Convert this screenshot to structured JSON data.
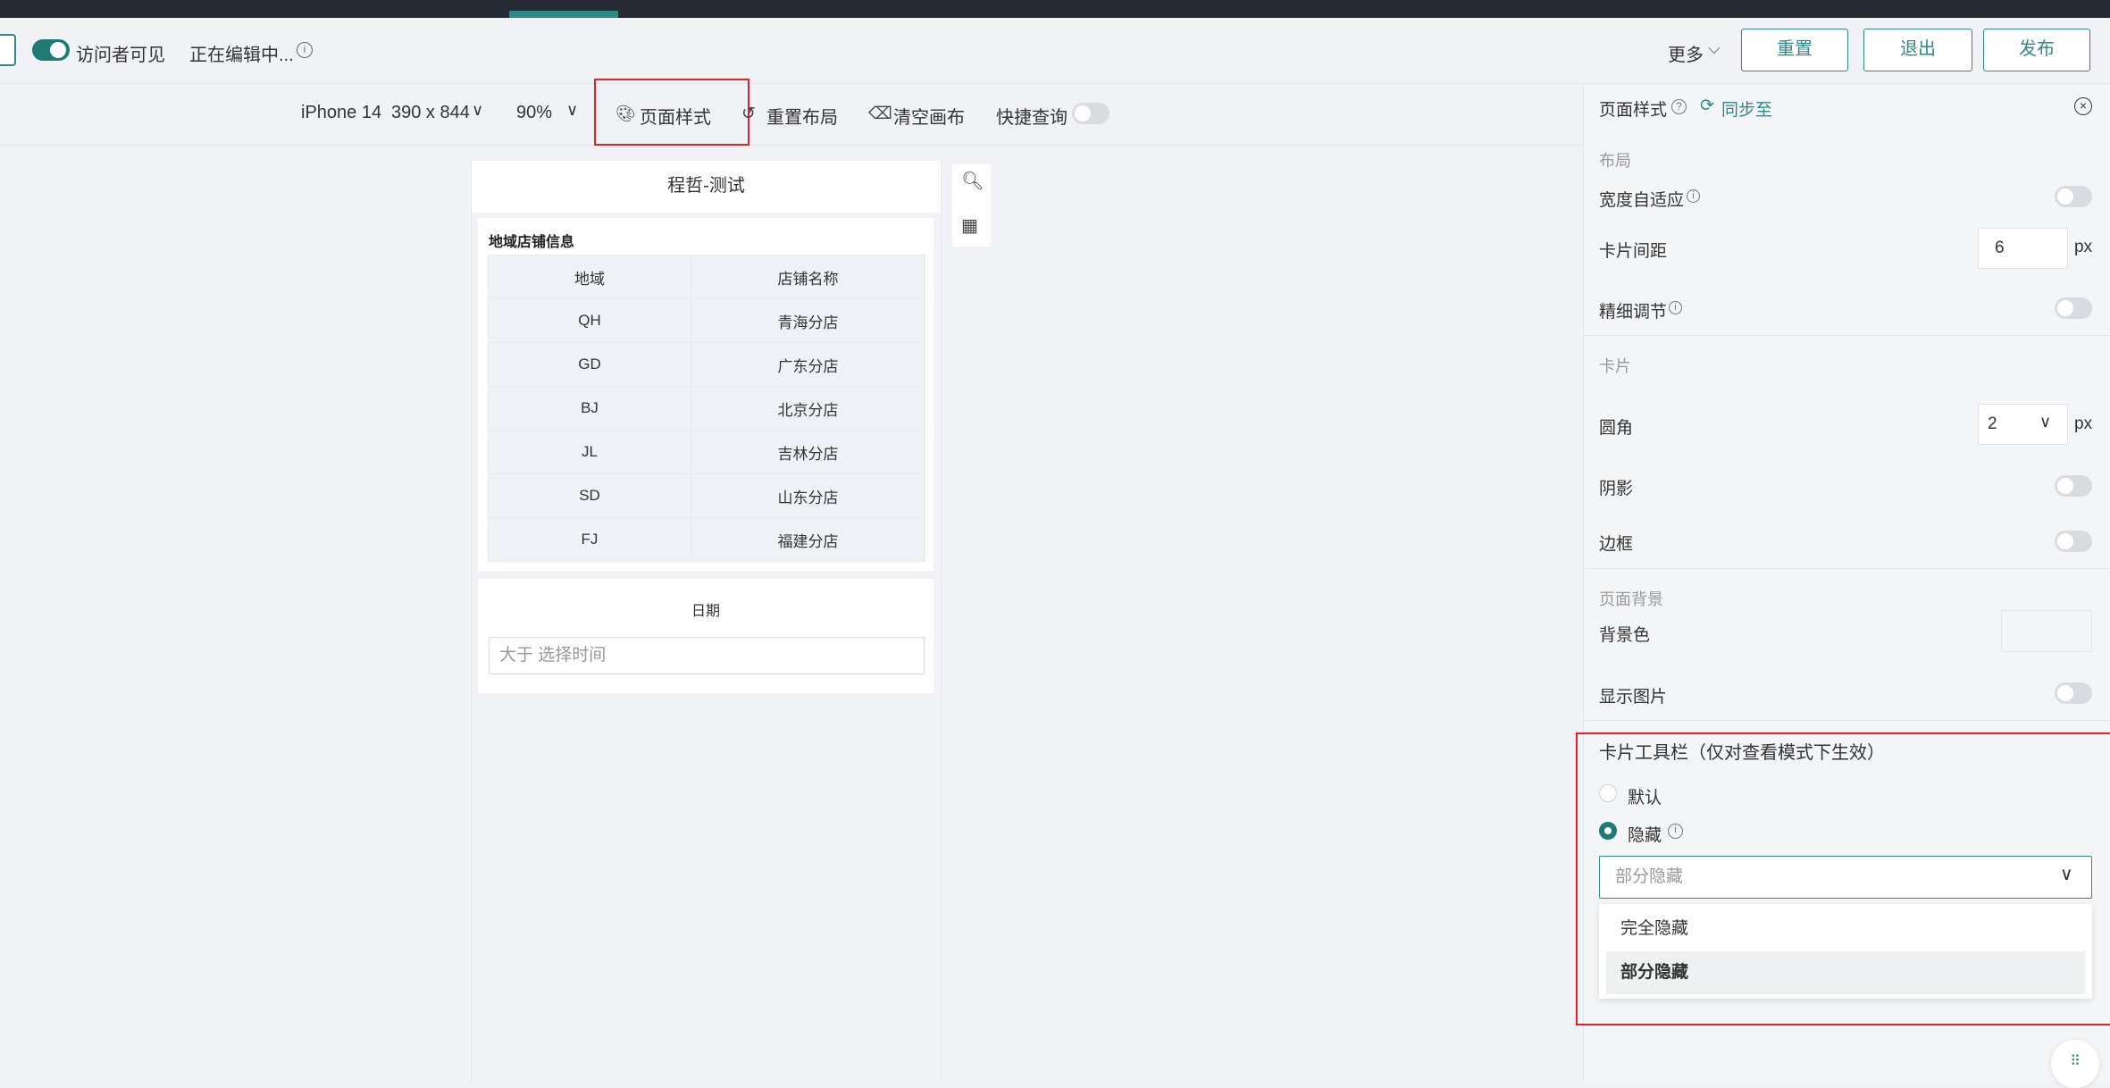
{
  "header": {
    "visitor_visible_label": "访问者可见",
    "editing_label": "正在编辑中...",
    "more_label": "更多",
    "reset_label": "重置",
    "exit_label": "退出",
    "publish_label": "发布"
  },
  "toolbar": {
    "device_name": "iPhone 14",
    "device_size": "390 x 844",
    "zoom": "90%",
    "page_style_label": "页面样式",
    "reset_layout_label": "重置布局",
    "clear_canvas_label": "清空画布",
    "quick_query_label": "快捷查询"
  },
  "canvas": {
    "page_title": "程哲-测试",
    "table_card": {
      "title": "地域店铺信息",
      "columns": [
        "地域",
        "店铺名称"
      ],
      "rows": [
        [
          "QH",
          "青海分店"
        ],
        [
          "GD",
          "广东分店"
        ],
        [
          "BJ",
          "北京分店"
        ],
        [
          "JL",
          "吉林分店"
        ],
        [
          "SD",
          "山东分店"
        ],
        [
          "FJ",
          "福建分店"
        ]
      ]
    },
    "date_card": {
      "title": "日期",
      "placeholder": "大于  选择时间"
    }
  },
  "panel": {
    "title": "页面样式",
    "sync_label": "同步至",
    "layout_section": "布局",
    "width_adaptive_label": "宽度自适应",
    "card_gap_label": "卡片间距",
    "card_gap_value": "6",
    "px_unit": "px",
    "fine_tune_label": "精细调节",
    "card_section": "卡片",
    "radius_label": "圆角",
    "radius_value": "2",
    "shadow_label": "阴影",
    "border_label": "边框",
    "bg_section": "页面背景",
    "bg_color_label": "背景色",
    "show_image_label": "显示图片",
    "card_toolbar_title": "卡片工具栏（仅对查看模式下生效）",
    "radio_default": "默认",
    "radio_hide": "隐藏",
    "hide_select_value": "部分隐藏",
    "hide_options": [
      "完全隐藏",
      "部分隐藏"
    ]
  },
  "colors": {
    "accent": "#2f8a85",
    "highlight": "#e1222a",
    "dark_bar": "#262b33"
  }
}
